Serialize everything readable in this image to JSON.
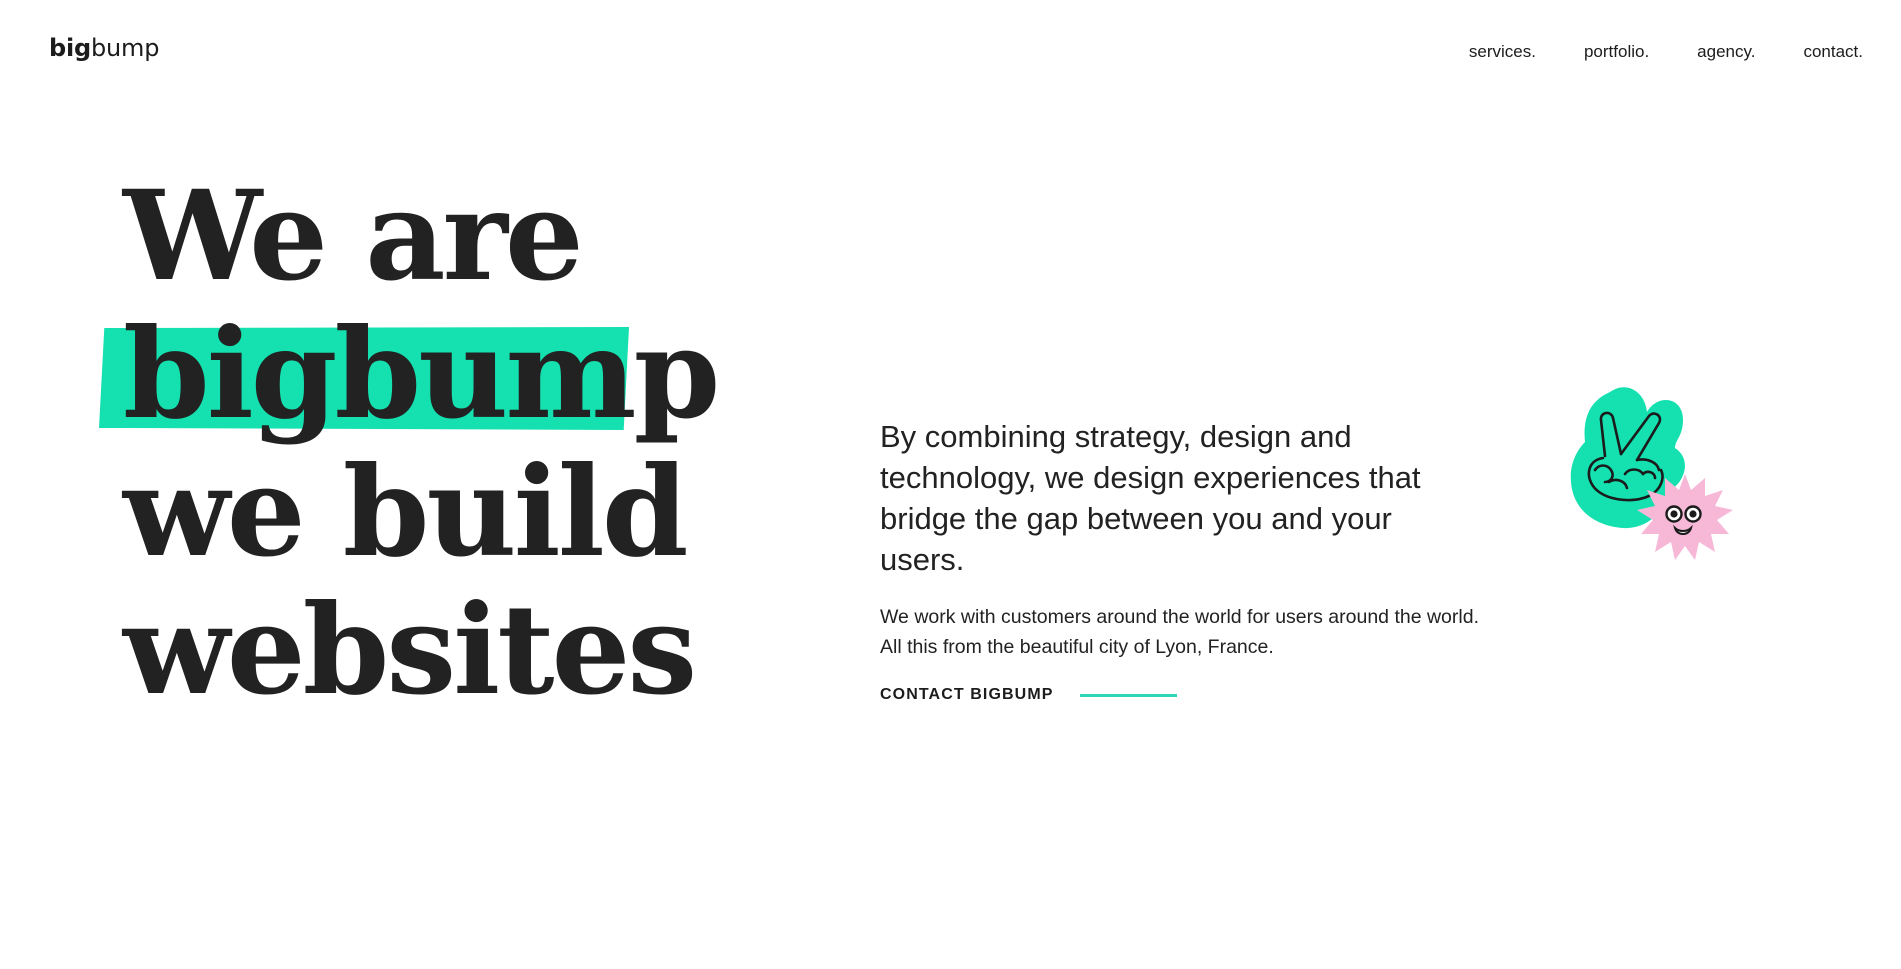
{
  "header": {
    "logo_bold": "big",
    "logo_light": "bump",
    "nav": [
      {
        "label": "services."
      },
      {
        "label": "portfolio."
      },
      {
        "label": "agency."
      },
      {
        "label": "contact."
      }
    ]
  },
  "hero": {
    "line1": "We are",
    "line2": "bigbump",
    "line3": "we build",
    "line4": "websites"
  },
  "intro": {
    "lead": "By combining strategy, design and technology, we design experiences that bridge the gap between you and your users.",
    "body": "We work with customers around the world for users around the world. All this from the beautiful city of Lyon, France.",
    "cta_label": "CONTACT BIGBUMP"
  },
  "illustration": {
    "icons": [
      "peace-hand-icon",
      "pink-star-face-icon"
    ]
  },
  "colors": {
    "accent": "#14e0b0",
    "text": "#222222",
    "pink": "#f7b8d8",
    "background": "#ffffff"
  }
}
